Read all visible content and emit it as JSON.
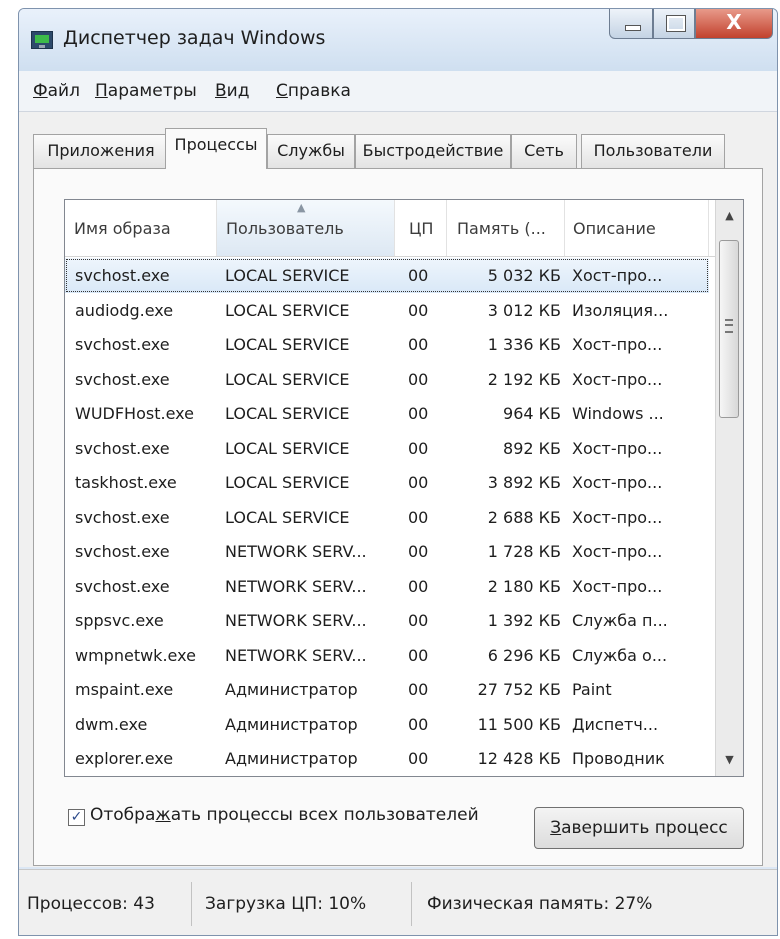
{
  "window": {
    "title": "Диспетчер задач Windows",
    "close_glyph": "X"
  },
  "menu": {
    "file": {
      "mnemonic": "Ф",
      "rest": "айл"
    },
    "options": {
      "mnemonic": "П",
      "rest": "араметры"
    },
    "view": {
      "mnemonic": "В",
      "rest": "ид"
    },
    "help": {
      "mnemonic": "С",
      "rest": "правка"
    }
  },
  "tabs": [
    {
      "label": "Приложения",
      "active": false
    },
    {
      "label": "Процессы",
      "active": true
    },
    {
      "label": "Службы",
      "active": false
    },
    {
      "label": "Быстродействие",
      "active": false
    },
    {
      "label": "Сеть",
      "active": false
    },
    {
      "label": "Пользователи",
      "active": false
    }
  ],
  "columns": {
    "name": "Имя образа",
    "user": "Пользователь",
    "cpu": "ЦП",
    "memory": "Память (...",
    "description": "Описание"
  },
  "processes": [
    {
      "name": "svchost.exe",
      "user": "LOCAL SERVICE",
      "cpu": "00",
      "memory": "5 032 КБ",
      "description": "Хост-про...",
      "selected": true
    },
    {
      "name": "audiodg.exe",
      "user": "LOCAL SERVICE",
      "cpu": "00",
      "memory": "3 012 КБ",
      "description": "Изоляция...",
      "selected": false
    },
    {
      "name": "svchost.exe",
      "user": "LOCAL SERVICE",
      "cpu": "00",
      "memory": "1 336 КБ",
      "description": "Хост-про...",
      "selected": false
    },
    {
      "name": "svchost.exe",
      "user": "LOCAL SERVICE",
      "cpu": "00",
      "memory": "2 192 КБ",
      "description": "Хост-про...",
      "selected": false
    },
    {
      "name": "WUDFHost.exe",
      "user": "LOCAL SERVICE",
      "cpu": "00",
      "memory": "964 КБ",
      "description": "Windows ...",
      "selected": false
    },
    {
      "name": "svchost.exe",
      "user": "LOCAL SERVICE",
      "cpu": "00",
      "memory": "892 КБ",
      "description": "Хост-про...",
      "selected": false
    },
    {
      "name": "taskhost.exe",
      "user": "LOCAL SERVICE",
      "cpu": "00",
      "memory": "3 892 КБ",
      "description": "Хост-про...",
      "selected": false
    },
    {
      "name": "svchost.exe",
      "user": "LOCAL SERVICE",
      "cpu": "00",
      "memory": "2 688 КБ",
      "description": "Хост-про...",
      "selected": false
    },
    {
      "name": "svchost.exe",
      "user": "NETWORK SERV...",
      "cpu": "00",
      "memory": "1 728 КБ",
      "description": "Хост-про...",
      "selected": false
    },
    {
      "name": "svchost.exe",
      "user": "NETWORK SERV...",
      "cpu": "00",
      "memory": "2 180 КБ",
      "description": "Хост-про...",
      "selected": false
    },
    {
      "name": "sppsvc.exe",
      "user": "NETWORK SERV...",
      "cpu": "00",
      "memory": "1 392 КБ",
      "description": "Служба п...",
      "selected": false
    },
    {
      "name": "wmpnetwk.exe",
      "user": "NETWORK SERV...",
      "cpu": "00",
      "memory": "6 296 КБ",
      "description": "Служба о...",
      "selected": false
    },
    {
      "name": "mspaint.exe",
      "user": "Администратор",
      "cpu": "00",
      "memory": "27 752 КБ",
      "description": "Paint",
      "selected": false
    },
    {
      "name": "dwm.exe",
      "user": "Администратор",
      "cpu": "00",
      "memory": "11 500 КБ",
      "description": "Диспетч...",
      "selected": false
    },
    {
      "name": "explorer.exe",
      "user": "Администратор",
      "cpu": "00",
      "memory": "12 428 КБ",
      "description": "Проводник",
      "selected": false
    }
  ],
  "show_all_users": {
    "checked": true,
    "label_before": "Отобра",
    "mnemonic": "ж",
    "label_after": "ать процессы всех пользователей"
  },
  "end_process_button": {
    "mnemonic": "З",
    "rest": "авершить процесс"
  },
  "status": {
    "processes": "Процессов: 43",
    "cpu_load": "Загрузка ЦП: 10%",
    "physical_memory": "Физическая память: 27%"
  }
}
